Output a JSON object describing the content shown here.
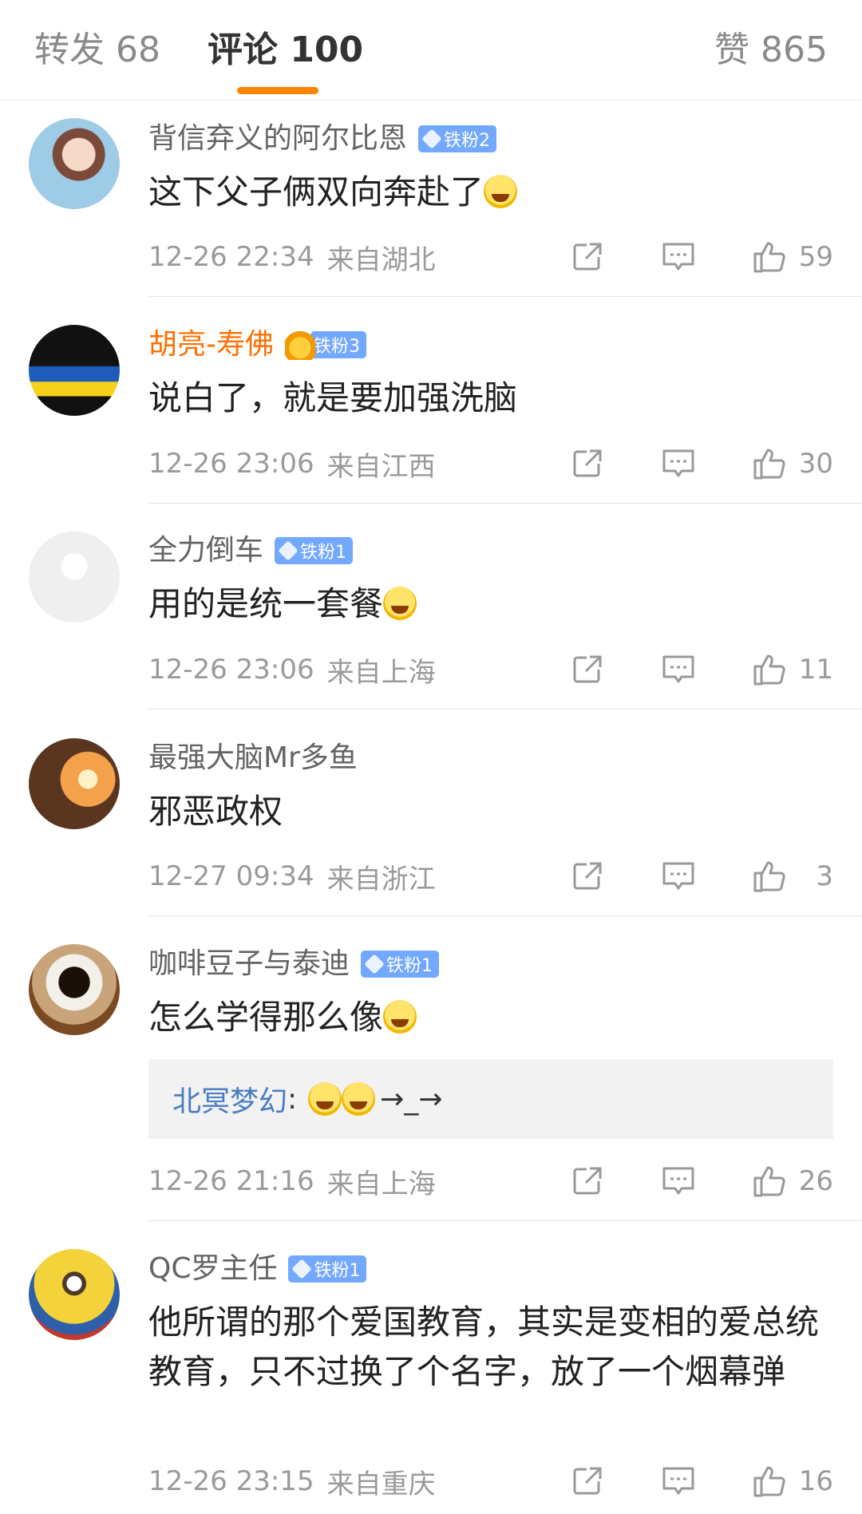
{
  "tabs": {
    "repost": "转发 68",
    "comment": "评论 100",
    "like": "赞 865"
  },
  "colors": {
    "accent": "#ff8200",
    "badge": "#73a8ff",
    "orange_name": "#ff6f00",
    "reply_user": "#4a7cc3"
  },
  "comments": [
    {
      "username": "背信弃义的阿尔比恩",
      "badge": "铁粉2",
      "text": "这下父子俩双向奔赴了",
      "time": "12-26 22:34",
      "location": "来自湖北",
      "likes": "59"
    },
    {
      "username": "胡亮-寿佛",
      "badge": "铁粉3",
      "text": "说白了，就是要加强洗脑",
      "time": "12-26 23:06",
      "location": "来自江西",
      "likes": "30"
    },
    {
      "username": "全力倒车",
      "badge": "铁粉1",
      "text": "用的是统一套餐",
      "time": "12-26 23:06",
      "location": "来自上海",
      "likes": "11"
    },
    {
      "username": "最强大脑Mr多鱼",
      "badge": "",
      "text": "邪恶政权",
      "time": "12-27 09:34",
      "location": "来自浙江",
      "likes": "3"
    },
    {
      "username": "咖啡豆子与泰迪",
      "badge": "铁粉1",
      "text": "怎么学得那么像",
      "reply_user": "北冥梦幻",
      "reply_text": "→_→",
      "time": "12-26 21:16",
      "location": "来自上海",
      "likes": "26"
    },
    {
      "username": "QC罗主任",
      "badge": "铁粉1",
      "text": "他所谓的那个爱国教育，其实是变相的爱总统教育，只不过换了个名字，放了一个烟幕弹",
      "time": "12-26 23:15",
      "location": "来自重庆",
      "likes": "16"
    }
  ]
}
